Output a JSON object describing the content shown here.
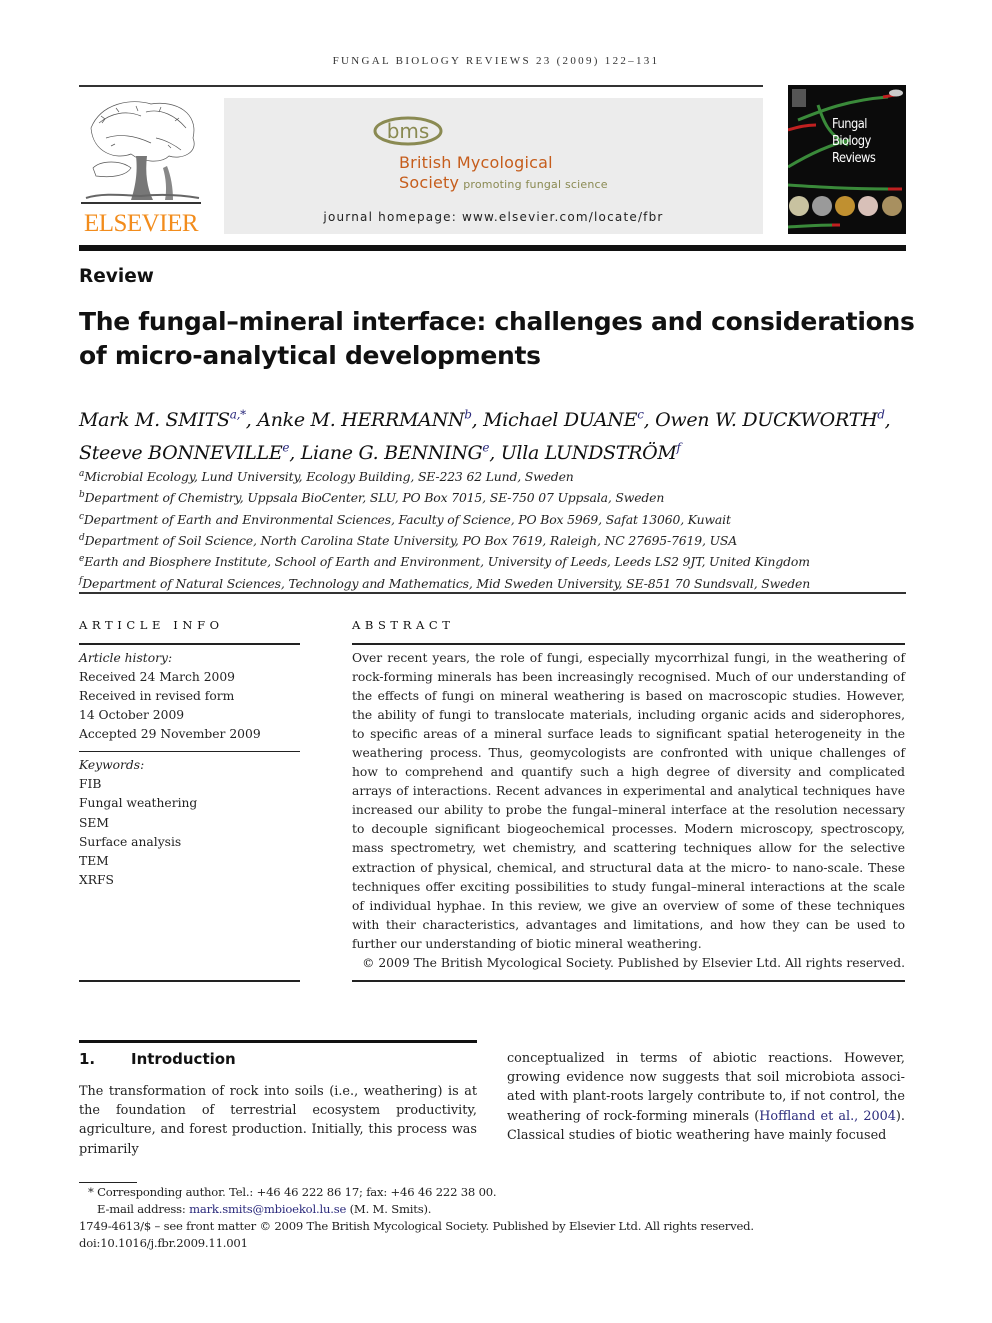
{
  "running_head": "FUNGAL BIOLOGY REVIEWS 23 (2009) 122–131",
  "publisher": {
    "logo_icon": "elsevier-tree-icon",
    "name": "ELSEVIER",
    "color": "#f28c1c"
  },
  "banner": {
    "society_logo_text": "bms",
    "society_name_line1": "British Mycological",
    "society_name_line2": "Society",
    "tagline": "promoting fungal science",
    "homepage": "journal homepage: www.elsevier.com/locate/fbr",
    "accent_color": "#c65d1c",
    "logo_color": "#8a8a52"
  },
  "cover": {
    "title_lines": [
      "Fungal",
      "Biology",
      "Reviews"
    ]
  },
  "article": {
    "type": "Review",
    "title": "The fungal–mineral interface: challenges and considerations of micro-analytical developments",
    "authors": [
      {
        "name": "Mark M. SMITS",
        "sup": "a,*"
      },
      {
        "name": "Anke M. HERRMANN",
        "sup": "b"
      },
      {
        "name": "Michael DUANE",
        "sup": "c"
      },
      {
        "name": "Owen W. DUCKWORTH",
        "sup": "d"
      },
      {
        "name": "Steeve BONNEVILLE",
        "sup": "e"
      },
      {
        "name": "Liane G. BENNING",
        "sup": "e"
      },
      {
        "name": "Ulla LUNDSTRÖM",
        "sup": "f"
      }
    ],
    "affiliations": [
      {
        "key": "a",
        "text": "Microbial Ecology, Lund University, Ecology Building, SE-223 62 Lund, Sweden"
      },
      {
        "key": "b",
        "text": "Department of Chemistry, Uppsala BioCenter, SLU, PO Box 7015, SE-750 07 Uppsala, Sweden"
      },
      {
        "key": "c",
        "text": "Department of Earth and Environmental Sciences, Faculty of Science, PO Box 5969, Safat 13060, Kuwait"
      },
      {
        "key": "d",
        "text": "Department of Soil Science, North Carolina State University, PO Box 7619, Raleigh, NC 27695-7619, USA"
      },
      {
        "key": "e",
        "text": "Earth and Biosphere Institute, School of Earth and Environment, University of Leeds, Leeds LS2 9JT, United Kingdom"
      },
      {
        "key": "f",
        "text": "Department of Natural Sciences, Technology and Mathematics, Mid Sweden University, SE-851 70 Sundsvall, Sweden"
      }
    ]
  },
  "article_info": {
    "heading": "ARTICLE INFO",
    "history_label": "Article history:",
    "history": [
      "Received 24 March 2009",
      "Received in revised form",
      "14 October 2009",
      "Accepted 29 November 2009"
    ],
    "keywords_label": "Keywords:",
    "keywords": [
      "FIB",
      "Fungal weathering",
      "SEM",
      "Surface analysis",
      "TEM",
      "XRFS"
    ]
  },
  "abstract": {
    "heading": "ABSTRACT",
    "text": "Over recent years, the role of fungi, especially mycorrhizal fungi, in the weathering of rock-forming minerals has been increasingly recognised. Much of our understanding of the effects of fungi on mineral weathering is based on macroscopic studies. However, the ability of fungi to translocate materials, including organic acids and siderophores, to specific areas of a mineral surface leads to significant spatial heterogeneity in the weath­ering process. Thus, geomycologists are confronted with unique challenges of how to comprehend and quantify such a high degree of diversity and complicated arrays of inter­actions. Recent advances in experimental and analytical techniques have increased our ability to probe the fungal–mineral interface at the resolution necessary to decouple signif­icant biogeochemical processes. Modern microscopy, spectroscopy, mass spectrometry, wet chemistry, and scattering techniques allow for the selective extraction of physical, chemical, and structural data at the micro- to nano-scale. These techniques offer exciting possibilities to study fungal–mineral interactions at the scale of individual hyphae. In this review, we give an overview of some of these techniques with their characteristics, advan­tages and limitations, and how they can be used to further our understanding of biotic mineral weathering.",
    "copyright": "© 2009 The British Mycological Society. Published by Elsevier Ltd. All rights reserved."
  },
  "introduction": {
    "number": "1.",
    "heading": "Introduction",
    "left_text": "The transformation of rock into soils (i.e., weathering) is at the foundation of terrestrial ecosystem productivity, agriculture, and forest production. Initially, this process was primarily",
    "right_text_before": "conceptualized in terms of abiotic reactions. However, growing evidence now suggests that soil microbiota associ­ated with plant-roots largely contribute to, if not control, the weathering of rock-forming minerals (",
    "citation": "Hoffland et al., 2004",
    "right_text_after": "). Classical studies of biotic weathering have mainly focused"
  },
  "footnotes": {
    "corresponding": "* Corresponding author. Tel.: +46 46 222 86 17; fax: +46 46 222 38 00.",
    "email_label": "E-mail address: ",
    "email": "mark.smits@mbioekol.lu.se",
    "email_suffix": " (M. M. Smits).",
    "front_matter": "1749-4613/$ – see front matter © 2009 The British Mycological Society. Published by Elsevier Ltd. All rights reserved.",
    "doi": "doi:10.1016/j.fbr.2009.11.001"
  },
  "link_color": "#2b2a7c"
}
